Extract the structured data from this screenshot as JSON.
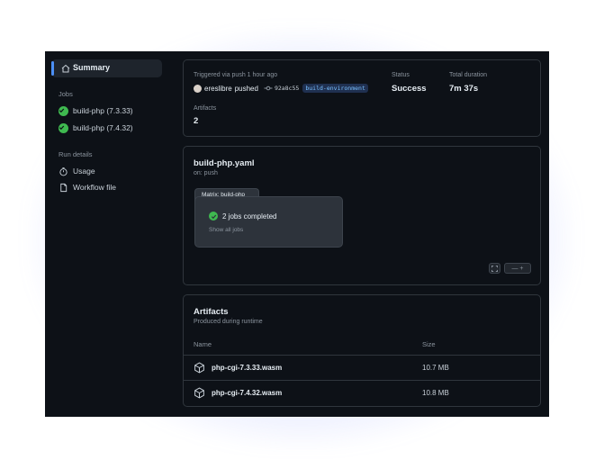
{
  "sidebar": {
    "summary_label": "Summary",
    "jobs_title": "Jobs",
    "jobs": [
      {
        "label": "build-php (7.3.33)"
      },
      {
        "label": "build-php (7.4.32)"
      }
    ],
    "run_details_title": "Run details",
    "details": [
      {
        "label": "Usage",
        "icon": "stopwatch-icon"
      },
      {
        "label": "Workflow file",
        "icon": "file-icon"
      }
    ]
  },
  "summary_card": {
    "trigger_text": "Triggered via push 1 hour ago",
    "user": "ereslibre",
    "action": "pushed",
    "commit": "92a8c55",
    "branch": "build-environment",
    "status_label": "Status",
    "status_value": "Success",
    "duration_label": "Total duration",
    "duration_value": "7m 37s",
    "artifacts_label": "Artifacts",
    "artifacts_count": "2"
  },
  "workflow_card": {
    "title": "build-php.yaml",
    "subtitle": "on: push",
    "matrix_tab": "Matrix: build-php",
    "jobs_completed": "2 jobs completed",
    "show_all": "Show all jobs",
    "zoom_controls": "— +"
  },
  "artifacts_card": {
    "title": "Artifacts",
    "subtitle": "Produced during runtime",
    "columns": [
      "Name",
      "Size"
    ],
    "rows": [
      {
        "name": "php-cgi-7.3.33.wasm",
        "size": "10.7 MB"
      },
      {
        "name": "php-cgi-7.4.32.wasm",
        "size": "10.8 MB"
      }
    ]
  },
  "colors": {
    "background": "#0d1117",
    "accent": "#4c8ff5",
    "success": "#3fb950",
    "branch_text": "#79c0ff"
  }
}
